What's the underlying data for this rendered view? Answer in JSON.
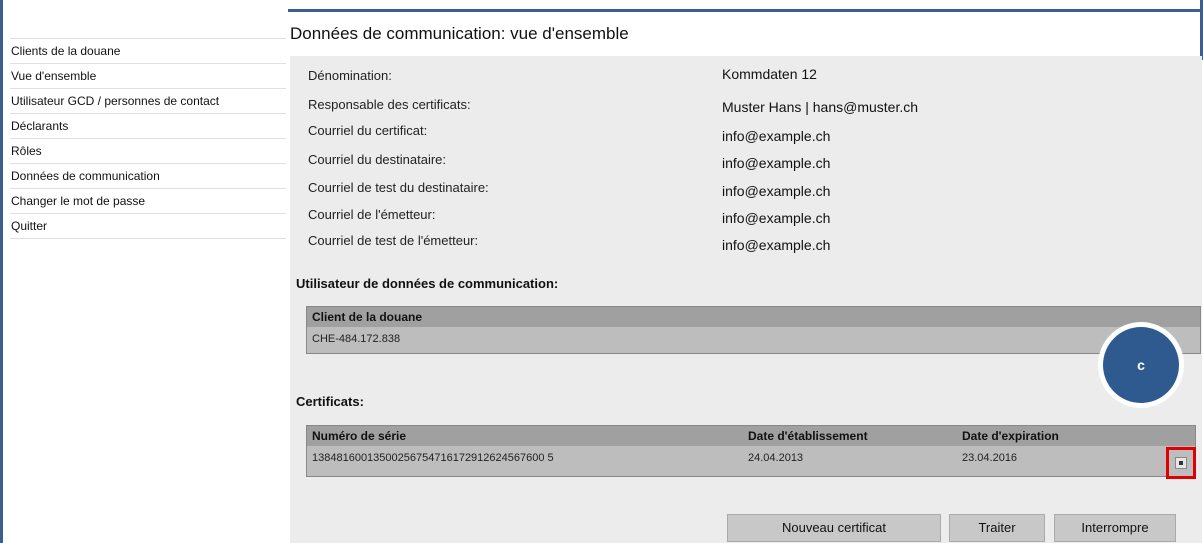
{
  "sidebar": {
    "items": [
      {
        "label": "Clients de la douane"
      },
      {
        "label": "Vue d'ensemble"
      },
      {
        "label": "Utilisateur GCD / personnes de contact"
      },
      {
        "label": "Déclarants"
      },
      {
        "label": "Rôles"
      },
      {
        "label": "Données de communication"
      },
      {
        "label": "Changer le mot de passe"
      },
      {
        "label": "Quitter"
      }
    ]
  },
  "page": {
    "title": "Données de communication: vue d'ensemble"
  },
  "fields": [
    {
      "label": "Dénomination:",
      "value": "Kommdaten 12"
    },
    {
      "label": "Responsable des certificats:",
      "value": "Muster Hans | hans@muster.ch"
    },
    {
      "label": "Courriel du certificat:",
      "value": "info@example.ch"
    },
    {
      "label": "Courriel du destinataire:",
      "value": "info@example.ch"
    },
    {
      "label": "Courriel de test du destinataire:",
      "value": "info@example.ch"
    },
    {
      "label": "Courriel de l'émetteur:",
      "value": "info@example.ch"
    },
    {
      "label": "Courriel de test de l'émetteur:",
      "value": "info@example.ch"
    }
  ],
  "users_section": {
    "title": "Utilisateur de données de communication:",
    "column": "Client de la douane",
    "rows": [
      "CHE-484.172.838"
    ]
  },
  "certificates": {
    "title": "Certificats:",
    "columns": [
      "Numéro de série",
      "Date d'établissement",
      "Date d'expiration"
    ],
    "rows": [
      {
        "serial": "13848160013500256754716172912624567600 5",
        "issued": "24.04.2013",
        "expires": "23.04.2016"
      }
    ]
  },
  "buttons": {
    "new_certificate": "Nouveau certificat",
    "process": "Traiter",
    "cancel": "Interrompre"
  },
  "annotation": {
    "badge_label": "c",
    "badge_color": "#2f5a8f",
    "highlight_color": "#e00000"
  }
}
